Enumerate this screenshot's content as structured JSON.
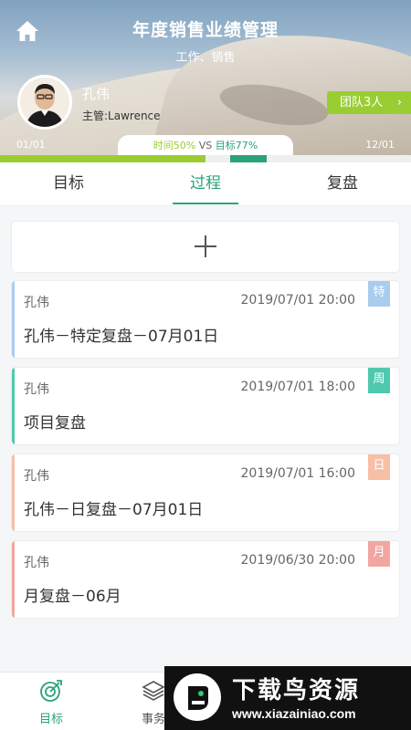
{
  "header": {
    "title": "年度销售业绩管理",
    "subtitle": "工作、销售",
    "user_name": "孔伟",
    "supervisor": "主管:Lawrence",
    "team_button": "团队3人",
    "start_date": "01/01",
    "end_date": "12/01",
    "time_label": "时间50%",
    "vs_label": "VS",
    "target_label": "目标77%",
    "time_progress": 0.5,
    "target_progress": 0.77,
    "colors": {
      "time": "#9acd32",
      "target": "#2aa27c"
    }
  },
  "tabs": [
    {
      "label": "目标",
      "active": false
    },
    {
      "label": "过程",
      "active": true
    },
    {
      "label": "复盘",
      "active": false
    }
  ],
  "add_button": {
    "icon": "plus-icon"
  },
  "cards": [
    {
      "author": "孔伟",
      "time": "2019/07/01 20:00",
      "tag": "特",
      "title": "孔伟－特定复盘－07月01日",
      "color": "#a9ccef"
    },
    {
      "author": "孔伟",
      "time": "2019/07/01 18:00",
      "tag": "周",
      "title": "项目复盘",
      "color": "#4fc9ad"
    },
    {
      "author": "孔伟",
      "time": "2019/07/01 16:00",
      "tag": "日",
      "title": "孔伟－日复盘－07月01日",
      "color": "#f6bfa6"
    },
    {
      "author": "孔伟",
      "time": "2019/06/30 20:00",
      "tag": "月",
      "title": "月复盘－06月",
      "color": "#f3a6a1"
    }
  ],
  "bottom_nav": [
    {
      "label": "目标",
      "icon": "target-icon",
      "active": true
    },
    {
      "label": "事务",
      "icon": "layers-icon",
      "active": false
    }
  ],
  "watermark": {
    "title": "下载鸟资源",
    "url": "www.xiazainiao.com"
  }
}
